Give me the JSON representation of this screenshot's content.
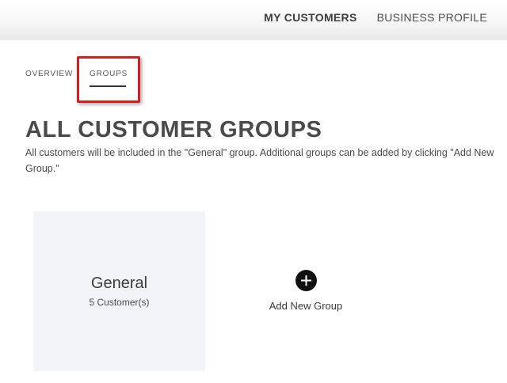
{
  "header": {
    "nav": [
      {
        "label": "MY CUSTOMERS",
        "active": true
      },
      {
        "label": "BUSINESS PROFILE",
        "active": false
      }
    ]
  },
  "subnav": {
    "tabs": [
      {
        "label": "OVERVIEW",
        "active": false
      },
      {
        "label": "GROUPS",
        "active": true
      }
    ]
  },
  "main": {
    "title": "ALL CUSTOMER GROUPS",
    "description": "All customers will be included in the \"General\" group. Additional groups can be added by clicking \"Add New Group.\"",
    "groups": [
      {
        "name": "General",
        "count_label": "5 Customer(s)"
      }
    ],
    "add_group": {
      "label": "Add New Group",
      "icon": "plus-circle-icon"
    }
  },
  "colors": {
    "highlight": "#d21f1f",
    "card_background": "#f1f4f9",
    "add_icon": "#111111"
  }
}
